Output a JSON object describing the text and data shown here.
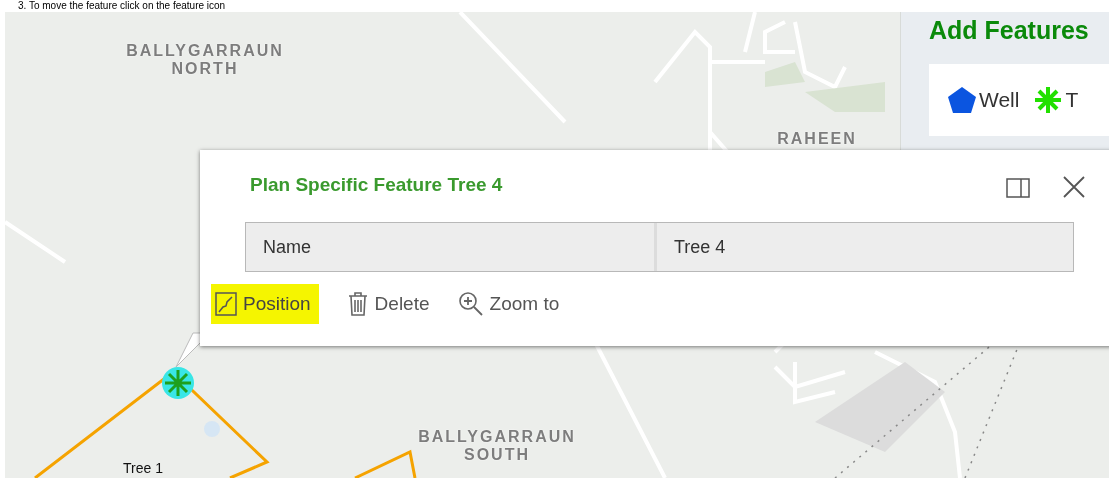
{
  "instruction": "3.  To move the feature click on the feature icon",
  "place_labels": [
    {
      "lines": [
        "BALLYGARRAUN",
        "NORTH"
      ]
    },
    {
      "lines": [
        "RAHEEN"
      ]
    },
    {
      "lines": [
        "BALLYGARRAUN",
        "SOUTH"
      ]
    }
  ],
  "feature_labels": [
    {
      "text": "Tree 1"
    }
  ],
  "add_features": {
    "title": "Add Features",
    "items": [
      {
        "label": "Well",
        "kind": "well"
      },
      {
        "label": "T",
        "kind": "tree"
      }
    ]
  },
  "popup": {
    "title": "Plan Specific Feature Tree 4",
    "fields": [
      {
        "name": "Name",
        "value": "Tree 4"
      }
    ],
    "actions": [
      {
        "label": "Position",
        "kind": "position",
        "highlighted": true
      },
      {
        "label": "Delete",
        "kind": "delete",
        "highlighted": false
      },
      {
        "label": "Zoom to",
        "kind": "zoom",
        "highlighted": false
      }
    ]
  }
}
